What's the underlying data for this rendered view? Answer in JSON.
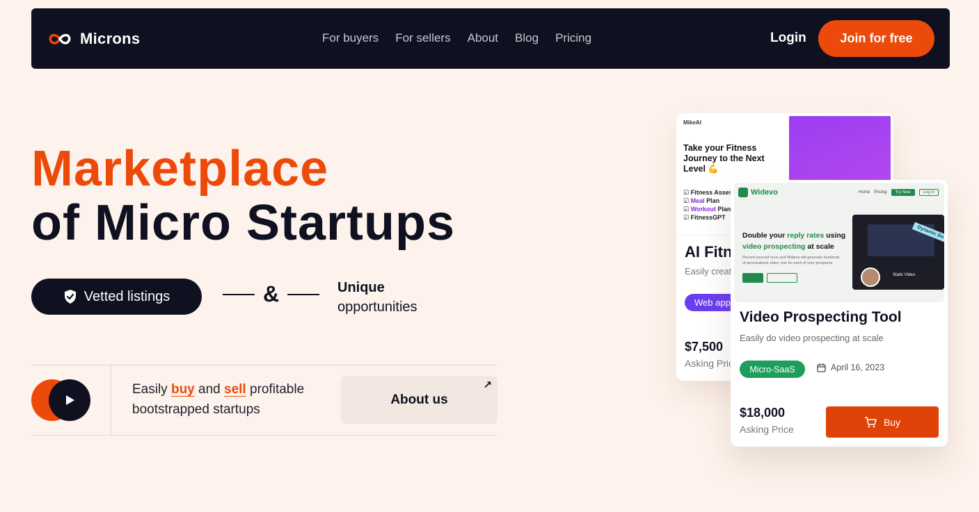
{
  "nav": {
    "brand": "Microns",
    "links": [
      "For buyers",
      "For sellers",
      "About",
      "Blog",
      "Pricing"
    ],
    "login": "Login",
    "join": "Join for free"
  },
  "hero": {
    "title_line1": "Marketplace",
    "title_line2": "of Micro Startups",
    "vetted": "Vetted listings",
    "amp": "&",
    "unique_bold": "Unique",
    "unique_rest": "opportunities",
    "tagline": {
      "pre": "Easily ",
      "buy": "buy",
      "and": " and ",
      "sell": "sell",
      "post": " profitable bootstrapped startups"
    },
    "about": "About us"
  },
  "card_back": {
    "brand": "MikeAI",
    "headline": "Take your Fitness Journey to the Next Level 💪",
    "features": [
      {
        "accent": "",
        "text": "Fitness Assessment",
        "lead": "Fitness "
      },
      {
        "accent": "Meal",
        "text": " Plan"
      },
      {
        "accent": "Workout",
        "text": " Plan"
      },
      {
        "accent": "",
        "text": "FitnessGPT"
      }
    ],
    "title": "AI Fitness Coach",
    "subtitle": "Easily create a fitness plan",
    "category": "Web app",
    "price": "$7,500",
    "asking": "Asking Price"
  },
  "card_front": {
    "brand": "Widevo",
    "nav_home": "Home",
    "nav_pricing": "Pricing",
    "nav_try": "Try Now",
    "nav_login": "Log in",
    "shot_headline_pre": "Double your ",
    "shot_headline_accent1": "reply rates",
    "shot_headline_mid": " using ",
    "shot_headline_accent2": "video prospecting",
    "shot_headline_post": " at scale",
    "shot_small": "Record yourself once and Widevo will generate hundreds of personalized video, one for each of your prospects",
    "static_video": "Static Video",
    "dynamic_badge": "Dynamic Bo",
    "title": "Video Prospecting Tool",
    "subtitle": "Easily do video prospecting at scale",
    "category": "Micro-SaaS",
    "date": "April 16, 2023",
    "price": "$18,000",
    "asking": "Asking Price",
    "buy": "Buy"
  },
  "colors": {
    "accent": "#ec4a0a",
    "dark": "#0f1020",
    "bg": "#fdf3ec",
    "green": "#1e9e5b",
    "purple": "#6a3df0"
  }
}
